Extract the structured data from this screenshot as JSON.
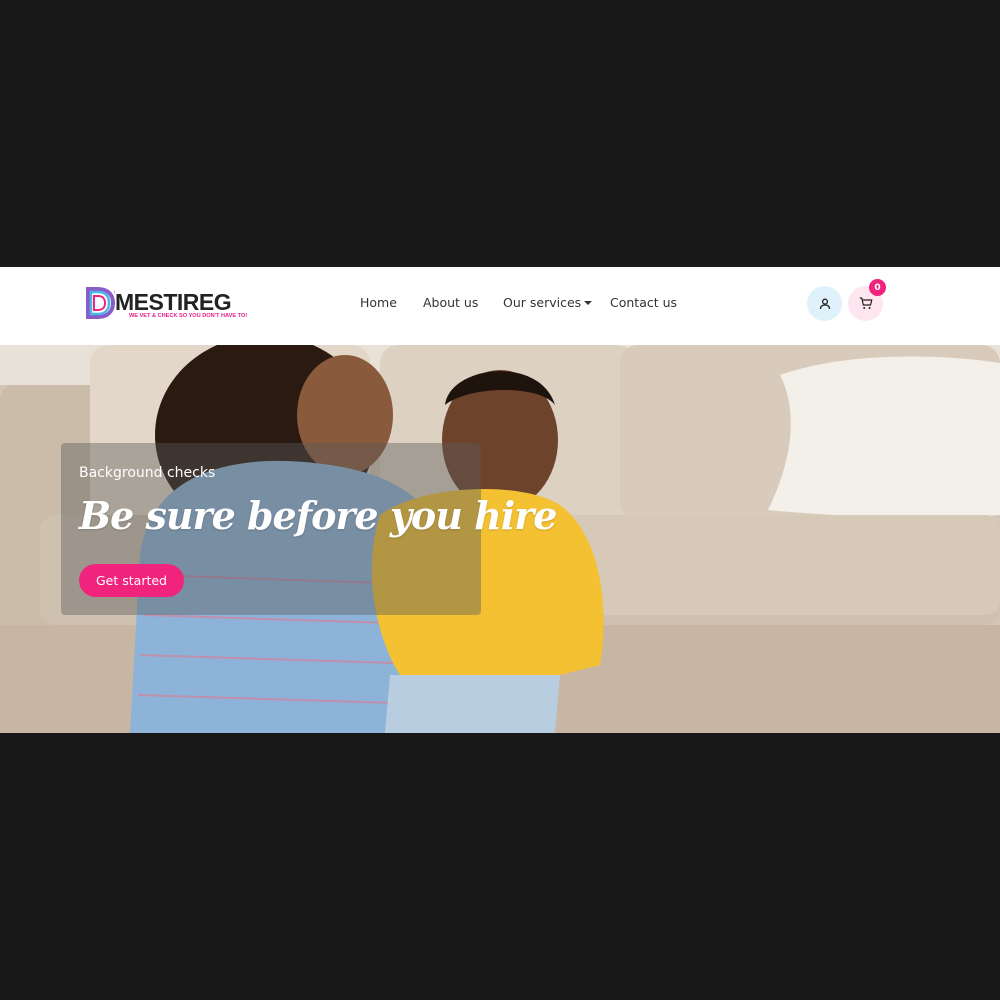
{
  "logo": {
    "name": "MESTIREG",
    "tagline": "WE VET & CHECK SO YOU DON'T HAVE TO!"
  },
  "nav": {
    "items": [
      {
        "label": "Home"
      },
      {
        "label": "About us"
      },
      {
        "label": "Our services",
        "has_dropdown": true
      },
      {
        "label": "Contact us"
      }
    ]
  },
  "actions": {
    "user_icon": "user-icon",
    "cart_icon": "cart-icon",
    "cart_count": "0"
  },
  "hero": {
    "subtitle": "Background checks",
    "title": "Be sure before you hire",
    "cta_label": "Get started"
  },
  "colors": {
    "accent": "#f0247d",
    "page_background": "#181818"
  }
}
